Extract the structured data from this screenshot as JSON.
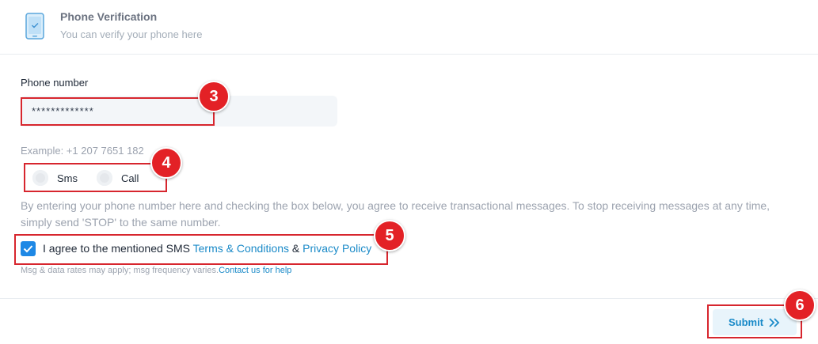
{
  "header": {
    "title": "Phone Verification",
    "subtitle": "You can verify your phone here",
    "icon": "phone-check-icon"
  },
  "phone_field": {
    "label": "Phone number",
    "value": "*************",
    "example": "Example: +1 207 7651 182"
  },
  "contact_method": {
    "options": [
      {
        "label": "Sms",
        "selected": false
      },
      {
        "label": "Call",
        "selected": false
      }
    ]
  },
  "consent": {
    "text": "By entering your phone number here and checking the box below, you agree to receive transactional messages. To stop receiving messages at any time, simply send 'STOP' to the same number."
  },
  "agreement": {
    "checked": true,
    "prefix": "I agree to the mentioned SMS ",
    "terms_link": "Terms & Conditions",
    "joiner": " & ",
    "privacy_link": "Privacy Policy"
  },
  "fineprint": {
    "text": "Msg & data rates may apply; msg frequency varies.",
    "link": "Contact us for help"
  },
  "submit": {
    "label": "Submit",
    "icon": "chevron-double-right-icon"
  },
  "annotations": [
    "3",
    "4",
    "5",
    "6"
  ],
  "colors": {
    "accent": "#1a8ac8",
    "checkbox": "#1e88e5",
    "annotation": "#e32126"
  }
}
